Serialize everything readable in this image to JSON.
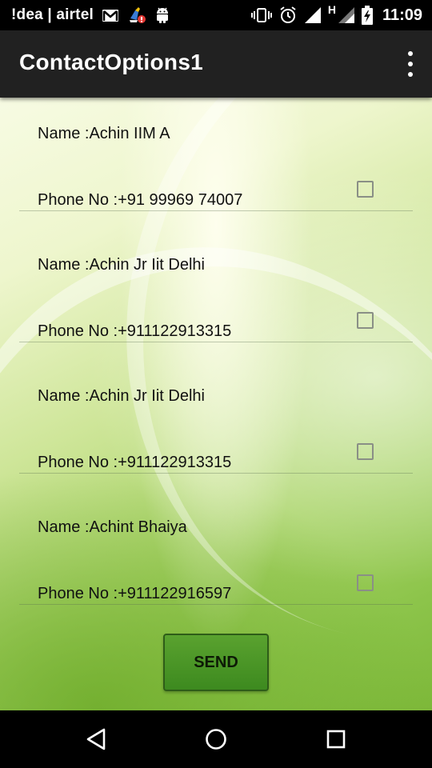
{
  "status_bar": {
    "carrier": "!dea | airtel",
    "time": "11:09",
    "network_label": "H",
    "icons": [
      "gmail-icon",
      "cleaner-alert-icon",
      "android-icon",
      "vibrate-icon",
      "alarm-icon",
      "signal-icon",
      "signal-icon-2",
      "battery-charging-icon"
    ]
  },
  "app": {
    "title": "ContactOptions1",
    "overflow_icon": "more-vert-icon"
  },
  "contacts": [
    {
      "name": "Name :Achin IIM A",
      "phone": "Phone No :+91 99969 74007",
      "checked": false
    },
    {
      "name": "Name :Achin Jr Iit Delhi",
      "phone": "Phone No :+911122913315",
      "checked": false
    },
    {
      "name": "Name :Achin Jr Iit Delhi",
      "phone": "Phone No :+911122913315",
      "checked": false
    },
    {
      "name": "Name :Achint Bhaiya",
      "phone": "Phone No :+911122916597",
      "checked": false
    }
  ],
  "send_button": {
    "label": "SEND"
  },
  "nav": {
    "back_icon": "back-triangle-icon",
    "home_icon": "home-circle-icon",
    "recents_icon": "recents-square-icon"
  },
  "colors": {
    "action_bar": "#212121",
    "send_button": "#4a9426",
    "status_bar": "#000000"
  }
}
